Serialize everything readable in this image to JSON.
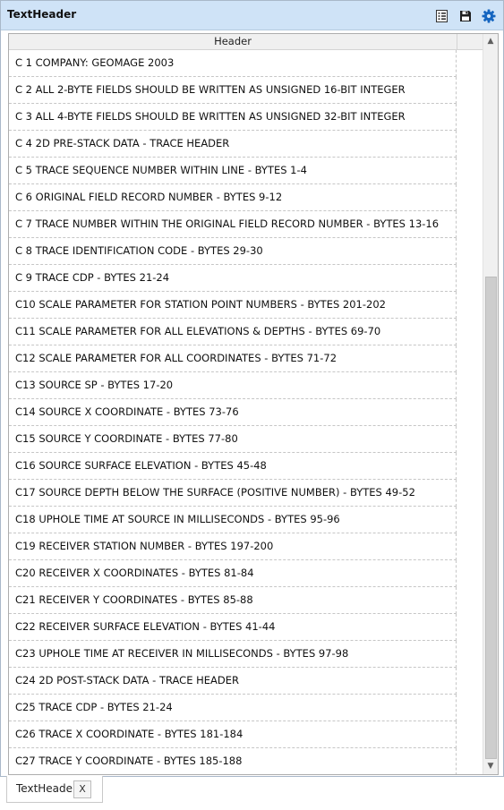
{
  "window": {
    "title": "TextHeader",
    "toolbar_icons": [
      "list-view-icon",
      "save-icon",
      "settings-gear-icon"
    ]
  },
  "grid": {
    "column_header": "Header",
    "rows": [
      "C 1  COMPANY: GEOMAGE 2003",
      "C 2  ALL 2-BYTE FIELDS SHOULD BE WRITTEN AS UNSIGNED 16-BIT INTEGER",
      "C 3  ALL 4-BYTE FIELDS SHOULD BE WRITTEN AS UNSIGNED 32-BIT INTEGER",
      "C 4  2D PRE-STACK DATA - TRACE HEADER",
      "C 5  TRACE SEQUENCE NUMBER WITHIN LINE - BYTES 1-4",
      "C 6  ORIGINAL FIELD RECORD NUMBER - BYTES 9-12",
      "C 7  TRACE NUMBER WITHIN THE ORIGINAL FIELD RECORD NUMBER - BYTES 13-16",
      "C 8  TRACE IDENTIFICATION CODE - BYTES 29-30",
      "C 9  TRACE CDP - BYTES 21-24",
      "C10  SCALE PARAMETER FOR STATION POINT NUMBERS - BYTES 201-202",
      "C11  SCALE PARAMETER FOR ALL ELEVATIONS & DEPTHS - BYTES 69-70",
      "C12  SCALE PARAMETER FOR ALL COORDINATES - BYTES 71-72",
      "C13  SOURCE SP - BYTES 17-20",
      "C14  SOURCE X COORDINATE - BYTES 73-76",
      "C15  SOURCE Y COORDINATE - BYTES 77-80",
      "C16  SOURCE SURFACE ELEVATION - BYTES 45-48",
      "C17  SOURCE DEPTH BELOW THE SURFACE (POSITIVE NUMBER) - BYTES 49-52",
      "C18  UPHOLE TIME AT SOURCE IN MILLISECONDS - BYTES 95-96",
      "C19  RECEIVER STATION NUMBER - BYTES 197-200",
      "C20  RECEIVER X COORDINATES - BYTES 81-84",
      "C21  RECEIVER Y COORDINATES - BYTES 85-88",
      "C22  RECEIVER SURFACE ELEVATION - BYTES 41-44",
      "C23  UPHOLE TIME AT RECEIVER IN MILLISECONDS - BYTES 97-98",
      "C24  2D POST-STACK DATA - TRACE HEADER",
      "C25  TRACE CDP - BYTES 21-24",
      "C26  TRACE X COORDINATE - BYTES 181-184",
      "C27  TRACE Y COORDINATE - BYTES 185-188"
    ],
    "scroll_position": 1.0,
    "visible_fraction": 0.68
  },
  "tabs": [
    {
      "label": "TextHeader",
      "close_label": "X"
    }
  ],
  "colors": {
    "titlebar": "#cfe3f7",
    "icon_blue": "#1565c0"
  }
}
